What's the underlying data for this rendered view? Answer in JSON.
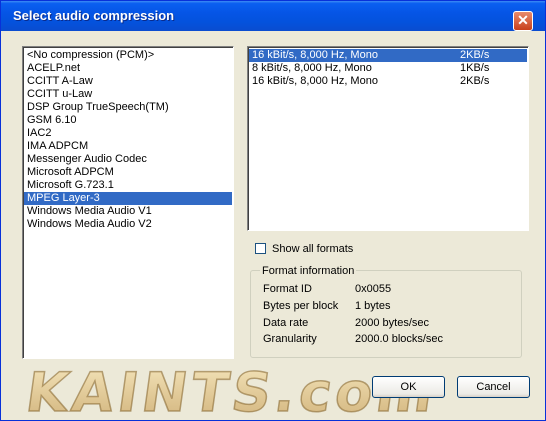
{
  "window": {
    "title": "Select audio compression",
    "close_glyph": "✕"
  },
  "codecs": [
    "<No compression (PCM)>",
    "ACELP.net",
    "CCITT A-Law",
    "CCITT u-Law",
    "DSP Group TrueSpeech(TM)",
    "GSM 6.10",
    "IAC2",
    "IMA ADPCM",
    "Messenger Audio Codec",
    "Microsoft ADPCM",
    "Microsoft G.723.1",
    "MPEG Layer-3",
    "Windows Media Audio V1",
    "Windows Media Audio V2"
  ],
  "selected_codec_index": 11,
  "formats": [
    {
      "desc": "16 kBit/s, 8,000 Hz, Mono",
      "size": "2KB/s"
    },
    {
      "desc": "8 kBit/s, 8,000 Hz, Mono",
      "size": "1KB/s"
    },
    {
      "desc": "16 kBit/s, 8,000 Hz, Mono",
      "size": "2KB/s"
    }
  ],
  "selected_format_index": 0,
  "show_all": {
    "label": "Show all formats",
    "checked": false
  },
  "format_info": {
    "caption": "Format information",
    "format_id_label": "Format ID",
    "format_id_value": "0x0055",
    "bytes_per_block_label": "Bytes per block",
    "bytes_per_block_value": "1 bytes",
    "data_rate_label": "Data rate",
    "data_rate_value": "2000 bytes/sec",
    "granularity_label": "Granularity",
    "granularity_value": "2000.0 blocks/sec"
  },
  "buttons": {
    "ok": "OK",
    "cancel": "Cancel"
  },
  "watermark": {
    "text": "KAINTS.com"
  },
  "colors": {
    "title_bar": "#0555e6",
    "selection": "#316ac5",
    "dialog_bg": "#ece9d8"
  }
}
